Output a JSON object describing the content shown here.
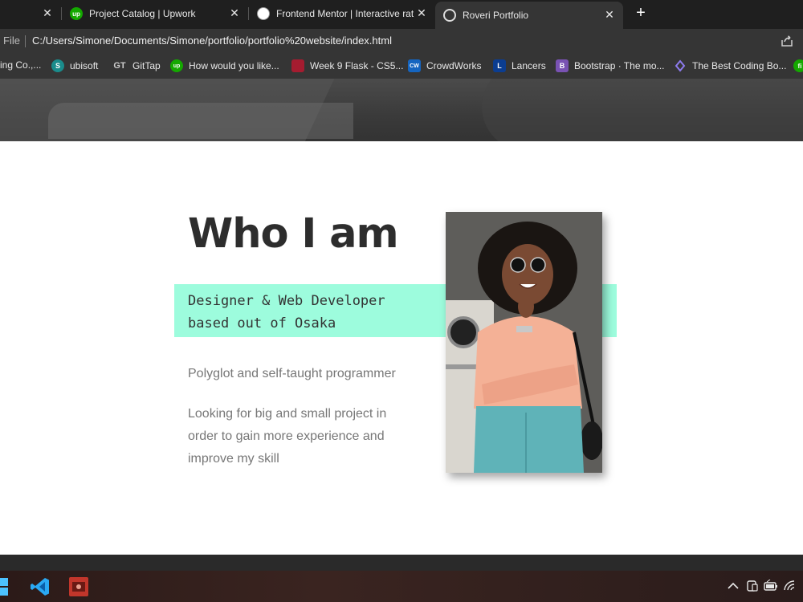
{
  "browser": {
    "tabs": [
      {
        "title": "",
        "favicon": "partial-tab",
        "active": false
      },
      {
        "title": "Project Catalog | Upwork",
        "favicon": "upwork-icon",
        "active": false
      },
      {
        "title": "Frontend Mentor | Interactive rat",
        "favicon": "frontend-mentor-icon",
        "active": false
      },
      {
        "title": "Roveri Portfolio",
        "favicon": "globe-icon",
        "active": true
      }
    ],
    "address": {
      "scheme": "File",
      "url": "C:/Users/Simone/Documents/Simone/portfolio/portfolio%20website/index.html"
    },
    "bookmarks": [
      {
        "label": "ing Co.,...",
        "icon": "generic",
        "color": "#777777",
        "glyph": ""
      },
      {
        "label": "ubisoft",
        "icon": "ubisoft-icon",
        "color": "#1a8c8c",
        "glyph": "S"
      },
      {
        "label": "GitTap",
        "icon": "gittap-icon",
        "color": "#353535",
        "glyph": "GT"
      },
      {
        "label": "How would you like...",
        "icon": "upwork-icon",
        "color": "#14a800",
        "glyph": "up"
      },
      {
        "label": "Week 9 Flask - CS5...",
        "icon": "harvard-icon",
        "color": "#a51c30",
        "glyph": ""
      },
      {
        "label": "CrowdWorks",
        "icon": "crowdworks-icon",
        "color": "#1565c0",
        "glyph": "CW"
      },
      {
        "label": "Lancers",
        "icon": "lancers-icon",
        "color": "#0b3d91",
        "glyph": "L"
      },
      {
        "label": "Bootstrap · The mo...",
        "icon": "bootstrap-icon",
        "color": "#7952b3",
        "glyph": "B"
      },
      {
        "label": "The Best Coding Bo...",
        "icon": "coding-icon",
        "color": "#6c5ce7",
        "glyph": ""
      },
      {
        "label": "",
        "icon": "partial-icon",
        "color": "#14a800",
        "glyph": "fi"
      }
    ]
  },
  "page": {
    "heading": "Who I am",
    "tagline_line1": "Designer & Web Developer",
    "tagline_line2": "based out of Osaka",
    "paragraph1": "Polyglot and self-taught programmer",
    "paragraph2": "Looking for big and small project in order to gain more experience and improve my skill",
    "accent_color": "#9dfcdd"
  },
  "taskbar": {
    "apps": [
      "windows-start-icon",
      "vscode-icon",
      "app-red-icon"
    ],
    "tray": [
      "chevron-up-icon",
      "phone-link-icon",
      "battery-icon",
      "wifi-icon"
    ]
  }
}
